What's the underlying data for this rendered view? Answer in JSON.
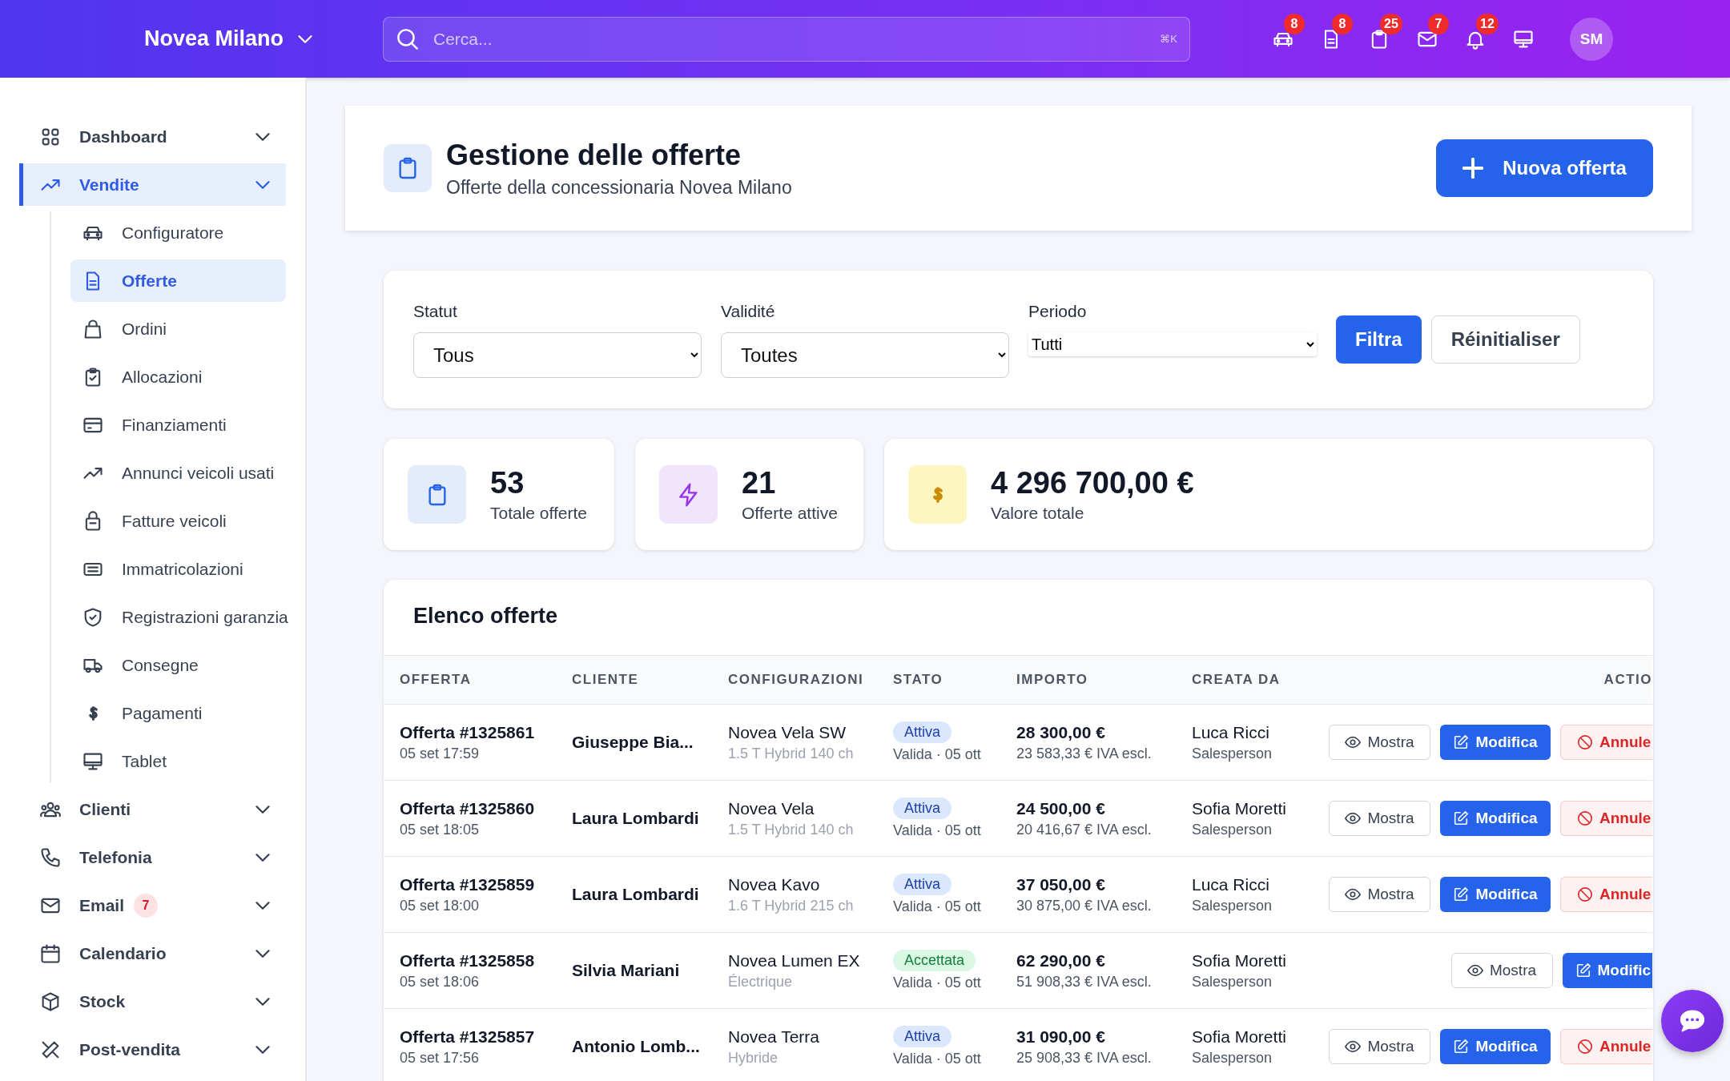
{
  "topbar": {
    "brand": "Novea Milano",
    "search": {
      "placeholder": "Cerca...",
      "shortcut": "⌘K"
    },
    "icons": [
      {
        "badge": "8"
      },
      {
        "badge": "8"
      },
      {
        "badge": "25"
      },
      {
        "badge": "7"
      },
      {
        "badge": "12"
      }
    ],
    "avatar": "SM"
  },
  "sidebar": {
    "items": [
      {
        "label": "Dashboard",
        "selected": false
      },
      {
        "label": "Vendite",
        "selected": true,
        "children": [
          {
            "label": "Configuratore",
            "selected": false
          },
          {
            "label": "Offerte",
            "selected": true
          },
          {
            "label": "Ordini",
            "selected": false
          },
          {
            "label": "Allocazioni",
            "selected": false
          },
          {
            "label": "Finanziamenti",
            "selected": false
          },
          {
            "label": "Annunci veicoli usati",
            "selected": false
          },
          {
            "label": "Fatture veicoli",
            "selected": false
          },
          {
            "label": "Immatricolazioni",
            "selected": false
          },
          {
            "label": "Registrazioni garanzia",
            "selected": false
          },
          {
            "label": "Consegne",
            "selected": false
          },
          {
            "label": "Pagamenti",
            "selected": false
          },
          {
            "label": "Tablet",
            "selected": false
          }
        ]
      },
      {
        "label": "Clienti",
        "selected": false
      },
      {
        "label": "Telefonia",
        "selected": false
      },
      {
        "label": "Email",
        "selected": false,
        "badge": "7"
      },
      {
        "label": "Calendario",
        "selected": false
      },
      {
        "label": "Stock",
        "selected": false
      },
      {
        "label": "Post-vendita",
        "selected": false
      }
    ]
  },
  "page_header": {
    "title": "Gestione delle offerte",
    "subtitle": "Offerte della concessionaria Novea Milano",
    "button": "Nuova offerta"
  },
  "filters": {
    "fields": [
      {
        "kind": "select",
        "label": "Statut",
        "value": "Tous"
      },
      {
        "kind": "select",
        "label": "Validité",
        "value": "Toutes"
      },
      {
        "kind": "compact",
        "label": "Periodo",
        "value": "Tutti"
      }
    ],
    "buttons": [
      {
        "label": "Filtra",
        "kind": "primary"
      },
      {
        "label": "Réinitialiser",
        "kind": "secondary"
      }
    ]
  },
  "stats": [
    {
      "value": "53",
      "label": "Totale offerte"
    },
    {
      "value": "21",
      "label": "Offerte attive"
    },
    {
      "value": "4 296 700,00 €",
      "label": "Valore totale"
    }
  ],
  "table": {
    "title": "Elenco offerte",
    "columns": [
      "OFFERTA",
      "CLIENTE",
      "CONFIGURAZIONI",
      "STATO",
      "IMPORTO",
      "CREATA DA",
      "ACTIO"
    ],
    "rows": [
      {
        "offer": "Offerta #1325861",
        "date": "05 set 17:59",
        "client": "Giuseppe Bia...",
        "model": "Novea Vela SW",
        "engine": "1.5 T Hybrid 140 ch",
        "status": {
          "label": "Attiva",
          "kind": "active"
        },
        "validity": "Valida · 05 ott",
        "amount": "28 300,00 €",
        "net": "23 583,33 € IVA escl.",
        "creator": "Luca Ricci",
        "role": "Salesperson",
        "actions": [
          {
            "label": "Mostra",
            "kind": "view"
          },
          {
            "label": "Modifica",
            "kind": "edit"
          },
          {
            "label": "Annule",
            "kind": "cancel"
          }
        ]
      },
      {
        "offer": "Offerta #1325860",
        "date": "05 set 18:05",
        "client": "Laura Lombardi",
        "model": "Novea Vela",
        "engine": "1.5 T Hybrid 140 ch",
        "status": {
          "label": "Attiva",
          "kind": "active"
        },
        "validity": "Valida · 05 ott",
        "amount": "24 500,00 €",
        "net": "20 416,67 € IVA escl.",
        "creator": "Sofia Moretti",
        "role": "Salesperson",
        "actions": [
          {
            "label": "Mostra",
            "kind": "view"
          },
          {
            "label": "Modifica",
            "kind": "edit"
          },
          {
            "label": "Annule",
            "kind": "cancel"
          }
        ]
      },
      {
        "offer": "Offerta #1325859",
        "date": "05 set 18:00",
        "client": "Laura Lombardi",
        "model": "Novea Kavo",
        "engine": "1.6 T Hybrid 215 ch",
        "status": {
          "label": "Attiva",
          "kind": "active"
        },
        "validity": "Valida · 05 ott",
        "amount": "37 050,00 €",
        "net": "30 875,00 € IVA escl.",
        "creator": "Luca Ricci",
        "role": "Salesperson",
        "actions": [
          {
            "label": "Mostra",
            "kind": "view"
          },
          {
            "label": "Modifica",
            "kind": "edit"
          },
          {
            "label": "Annule",
            "kind": "cancel"
          }
        ]
      },
      {
        "offer": "Offerta #1325858",
        "date": "05 set 18:06",
        "client": "Silvia Mariani",
        "model": "Novea Lumen EX",
        "engine": "Électrique",
        "status": {
          "label": "Accettata",
          "kind": "accepted"
        },
        "validity": "Valida · 05 ott",
        "amount": "62 290,00 €",
        "net": "51 908,33 € IVA escl.",
        "creator": "Sofia Moretti",
        "role": "Salesperson",
        "actions": [
          {
            "label": "Mostra",
            "kind": "view"
          },
          {
            "label": "Modific",
            "kind": "edit"
          }
        ]
      },
      {
        "offer": "Offerta #1325857",
        "date": "05 set 17:56",
        "client": "Antonio Lomb...",
        "model": "Novea Terra",
        "engine": "Hybride",
        "status": {
          "label": "Attiva",
          "kind": "active"
        },
        "validity": "Valida · 05 ott",
        "amount": "31 090,00 €",
        "net": "25 908,33 € IVA escl.",
        "creator": "Sofia Moretti",
        "role": "Salesperson",
        "actions": [
          {
            "label": "Mostra",
            "kind": "view"
          },
          {
            "label": "Modifica",
            "kind": "edit"
          },
          {
            "label": "Annule",
            "kind": "cancel"
          }
        ]
      }
    ]
  }
}
